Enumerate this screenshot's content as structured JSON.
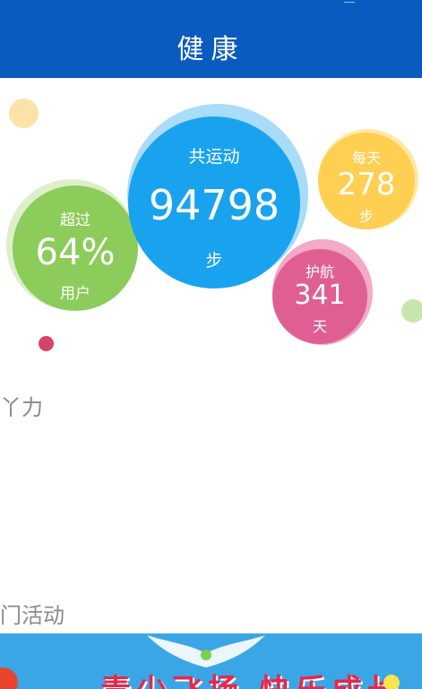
{
  "header": {
    "title": "健康"
  },
  "stats": {
    "percent": {
      "top": "超过",
      "value": "64%",
      "bottom": "用户"
    },
    "total": {
      "top": "共运动",
      "value": "94798",
      "bottom": "步"
    },
    "daily": {
      "top": "每天",
      "value": "278",
      "bottom": "步"
    },
    "days": {
      "top": "护航",
      "value": "341",
      "bottom": "天"
    }
  },
  "sections": {
    "vitality": "丫力",
    "popular": "门活动"
  },
  "banner": {
    "text": "青少飞扬 快乐成长"
  },
  "colors": {
    "header": "#0a5bbf",
    "green": "#8ccc5a",
    "blue": "#19a3ef",
    "yellow": "#ffcf52",
    "pink": "#e05f93",
    "dot_red": "#d5436a"
  }
}
